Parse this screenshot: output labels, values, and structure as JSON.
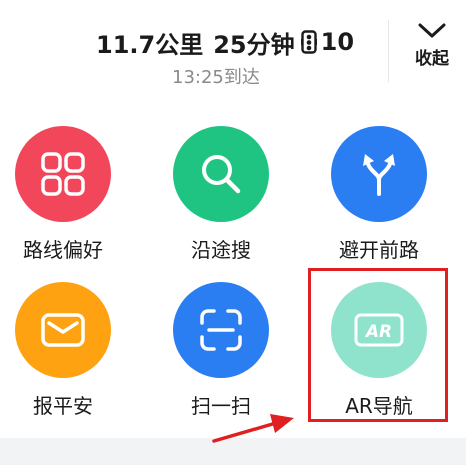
{
  "header": {
    "distance": "11.7公里",
    "duration": "25分钟",
    "traffic_lights": "10",
    "arrival": "13:25到达",
    "collapse_label": "收起"
  },
  "actions": [
    {
      "label": "路线偏好",
      "icon": "route-preference-icon",
      "color": "#f2475a"
    },
    {
      "label": "沿途搜",
      "icon": "search-icon",
      "color": "#1fc482"
    },
    {
      "label": "避开前路",
      "icon": "fork-arrows-icon",
      "color": "#2b7ef2"
    },
    {
      "label": "报平安",
      "icon": "envelope-icon",
      "color": "#ffa211"
    },
    {
      "label": "扫一扫",
      "icon": "scan-icon",
      "color": "#2b7ef2"
    },
    {
      "label": "AR导航",
      "icon": "ar-icon",
      "color": "#8fe3cc"
    }
  ],
  "colors": {
    "annotation_red": "#e02020",
    "text_dark": "#1b1b1b",
    "text_gray": "#8a8a8a"
  }
}
